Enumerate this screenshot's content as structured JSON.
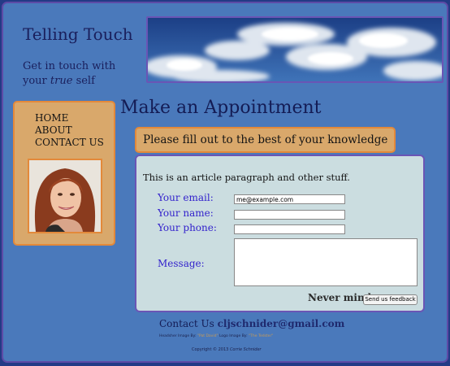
{
  "header": {
    "site_title": "Telling Touch",
    "tagline_line1": "Get in touch with",
    "tagline_prefix": "your",
    "tagline_emphasis": "true",
    "tagline_suffix": "self",
    "image_icon": "sky-clouds-image"
  },
  "sidebar": {
    "nav": [
      {
        "label": "HOME"
      },
      {
        "label": "ABOUT"
      },
      {
        "label": "CONTACT US"
      }
    ],
    "avatar_icon": "woman-portrait-avatar"
  },
  "main": {
    "page_title": "Make an Appointment",
    "subheading": "Please fill out to the best of your knowledge",
    "intro": "This is an article paragraph and other stuff.",
    "form": {
      "email_label": "Your email:",
      "email_value": "me@example.com",
      "name_label": "Your name:",
      "name_value": "",
      "phone_label": "Your phone:",
      "phone_value": "",
      "message_label": "Message:",
      "message_value": "",
      "never_mind": "Never mind",
      "send_label": "Send us feedback"
    }
  },
  "footer": {
    "contact_prefix": "Contact Us",
    "contact_email": "cljschnider@gmail.com",
    "credit_header_prefix": "Headsher Image By:",
    "credit_header_name": "\"Pat David\"",
    "credit_logo_prefix": "Logo Image By:",
    "credit_logo_name": "\"The Tedster\"",
    "copyright_prefix": "Copyright © 2013",
    "copyright_owner": "Corrie Schnider"
  },
  "colors": {
    "background": "#4a79bb",
    "accent_orange": "#d9a86b",
    "accent_border": "#e3893a",
    "form_bg": "#cbdde0",
    "label_blue": "#3322cc"
  }
}
